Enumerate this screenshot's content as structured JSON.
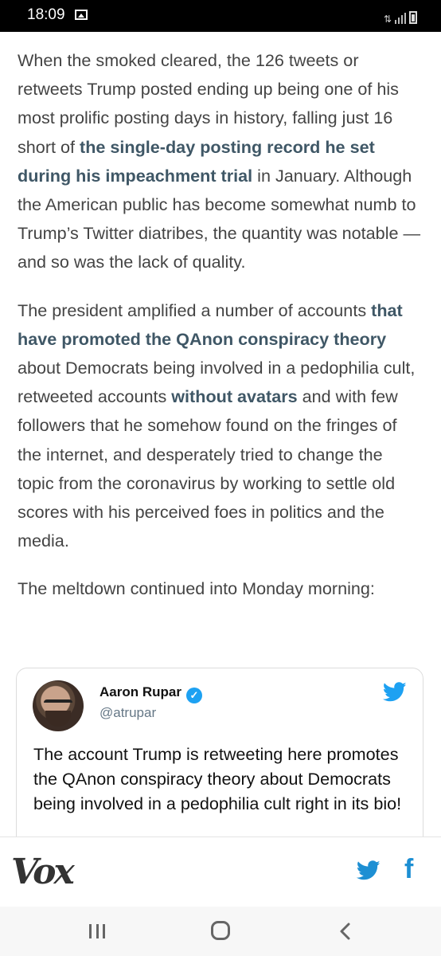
{
  "status_bar": {
    "time": "18:09",
    "icons": [
      "gallery-icon",
      "signal-icon",
      "battery-icon"
    ]
  },
  "article": {
    "p1": {
      "t1": "When the smoked cleared, the 126 tweets or retweets Trump posted ending up being one of his most prolific posting days in history, falling just 16 short of ",
      "link": "the single-day posting record he set during his impeachment trial",
      "t2": " in January. Although the American public has become somewhat numb to Trump’s Twitter diatribes, the quantity was notable — and so was the lack of quality."
    },
    "p2": {
      "t1": "The president amplified a number of accounts ",
      "link1": "that have promoted the QAnon conspiracy theory",
      "t2": " about Democrats being involved in a pedophilia cult, retweeted accounts ",
      "link2": "without avatars",
      "t3": " and with few followers that he somehow found on the fringes of the internet, and desperately tried to change the topic from the coronavirus by working to settle old scores with his perceived foes in politics and the media."
    },
    "p3": "The meltdown continued into Monday morning:"
  },
  "tweet": {
    "author_name": "Aaron Rupar",
    "handle": "@atrupar",
    "text": "The account Trump is retweeting here promotes the QAnon conspiracy theory about Democrats being involved in a pedophilia cult right in its bio!"
  },
  "footer": {
    "logo": "Vox",
    "share_facebook": "f"
  },
  "colors": {
    "link": "#3f5766",
    "twitter_blue": "#1da1f2",
    "share_blue": "#1d8fd3",
    "body_text": "#444444"
  }
}
